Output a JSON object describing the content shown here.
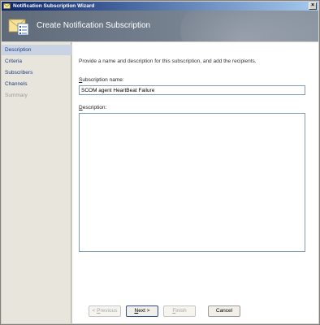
{
  "window": {
    "title": "Notification Subscription Wizard",
    "close_glyph": "×"
  },
  "header": {
    "title": "Create Notification Subscription",
    "icon": "notification-subscription-icon"
  },
  "sidebar": {
    "items": [
      {
        "label": "Description",
        "state": "active"
      },
      {
        "label": "Criteria",
        "state": "enabled"
      },
      {
        "label": "Subscribers",
        "state": "enabled"
      },
      {
        "label": "Channels",
        "state": "enabled"
      },
      {
        "label": "Summary",
        "state": "disabled"
      }
    ]
  },
  "main": {
    "intro": "Provide a name and description for this subscription, and add the recipients.",
    "name_label_first": "S",
    "name_label_rest": "ubscription name:",
    "name_value": "SCOM agent HeartBeat Failure",
    "description_label_first": "D",
    "description_label_rest": "escription:",
    "description_value": ""
  },
  "buttons": {
    "previous": {
      "arrow": "< ",
      "accel": "P",
      "rest": "revious",
      "enabled": false
    },
    "next": {
      "accel": "N",
      "rest": "ext >",
      "enabled": true
    },
    "finish": {
      "accel": "F",
      "rest": "inish",
      "enabled": false
    },
    "cancel": {
      "label": "Cancel",
      "enabled": true
    }
  },
  "colors": {
    "titlebar_start": "#0a246a",
    "titlebar_end": "#a6caf0",
    "header_bg": "#6f7a89",
    "sidebar_bg": "#e8e5dd",
    "sidebar_active": "#c9d3e4",
    "link_text": "#1f3f7a"
  }
}
